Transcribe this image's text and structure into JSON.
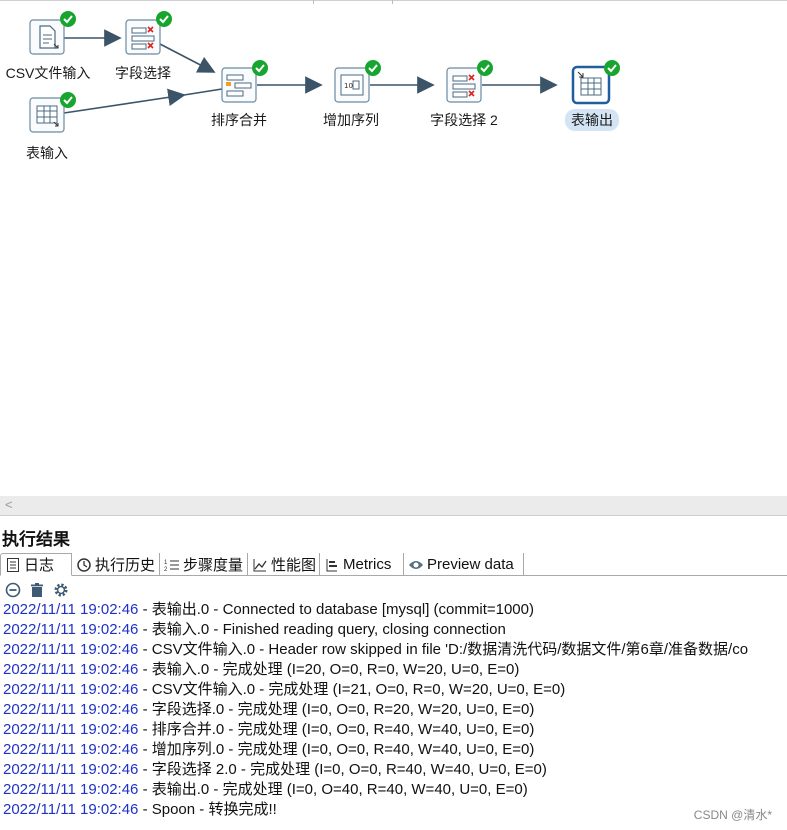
{
  "canvas": {
    "steps": [
      {
        "id": "csv",
        "label": "CSV文件输入",
        "icon": "csv-file-input-icon",
        "status": "success"
      },
      {
        "id": "select1",
        "label": "字段选择",
        "icon": "select-values-icon",
        "status": "success"
      },
      {
        "id": "table_in",
        "label": "表输入",
        "icon": "table-input-icon",
        "status": "success"
      },
      {
        "id": "sort_merge",
        "label": "排序合并",
        "icon": "sorted-merge-icon",
        "status": "success"
      },
      {
        "id": "add_seq",
        "label": "增加序列",
        "icon": "add-sequence-icon",
        "status": "success"
      },
      {
        "id": "select2",
        "label": "字段选择 2",
        "icon": "select-values-icon",
        "status": "success"
      },
      {
        "id": "table_out",
        "label": "表输出",
        "icon": "table-output-icon",
        "status": "success",
        "selected": true
      }
    ]
  },
  "results": {
    "title": "执行结果",
    "tabs": [
      {
        "label": "日志",
        "icon": "log-icon",
        "active": true
      },
      {
        "label": "执行历史",
        "icon": "history-icon"
      },
      {
        "label": "步骤度量",
        "icon": "step-metrics-icon"
      },
      {
        "label": "性能图",
        "icon": "performance-chart-icon"
      },
      {
        "label": "Metrics",
        "icon": "metrics-icon"
      },
      {
        "label": "Preview data",
        "icon": "preview-eye-icon"
      }
    ],
    "toolbar": [
      "stop-icon",
      "trash-icon",
      "settings-icon"
    ],
    "log": [
      {
        "ts": "2022/11/11 19:02:46",
        "msg": " - 表输出.0 - Connected to database [mysql] (commit=1000)"
      },
      {
        "ts": "2022/11/11 19:02:46",
        "msg": " - 表输入.0 - Finished reading query, closing connection"
      },
      {
        "ts": "2022/11/11 19:02:46",
        "msg": " - CSV文件输入.0 - Header row skipped in file 'D:/数据清洗代码/数据文件/第6章/准备数据/co"
      },
      {
        "ts": "2022/11/11 19:02:46",
        "msg": " - 表输入.0 - 完成处理 (I=20, O=0, R=0, W=20, U=0, E=0)"
      },
      {
        "ts": "2022/11/11 19:02:46",
        "msg": " - CSV文件输入.0 - 完成处理 (I=21, O=0, R=0, W=20, U=0, E=0)"
      },
      {
        "ts": "2022/11/11 19:02:46",
        "msg": " - 字段选择.0 - 完成处理 (I=0, O=0, R=20, W=20, U=0, E=0)"
      },
      {
        "ts": "2022/11/11 19:02:46",
        "msg": " - 排序合并.0 - 完成处理 (I=0, O=0, R=40, W=40, U=0, E=0)"
      },
      {
        "ts": "2022/11/11 19:02:46",
        "msg": " - 增加序列.0 - 完成处理 (I=0, O=0, R=40, W=40, U=0, E=0)"
      },
      {
        "ts": "2022/11/11 19:02:46",
        "msg": " - 字段选择 2.0 - 完成处理 (I=0, O=0, R=40, W=40, U=0, E=0)"
      },
      {
        "ts": "2022/11/11 19:02:46",
        "msg": " - 表输出.0 - 完成处理 (I=0, O=40, R=40, W=40, U=0, E=0)"
      },
      {
        "ts": "2022/11/11 19:02:46",
        "msg": " - Spoon - 转换完成!!"
      }
    ]
  },
  "watermark": "CSDN @清水*",
  "colors": {
    "timestamp": "#1f32c6",
    "success": "#17a52f",
    "hop": "#3c5468",
    "selected": "#d4e4f4"
  }
}
